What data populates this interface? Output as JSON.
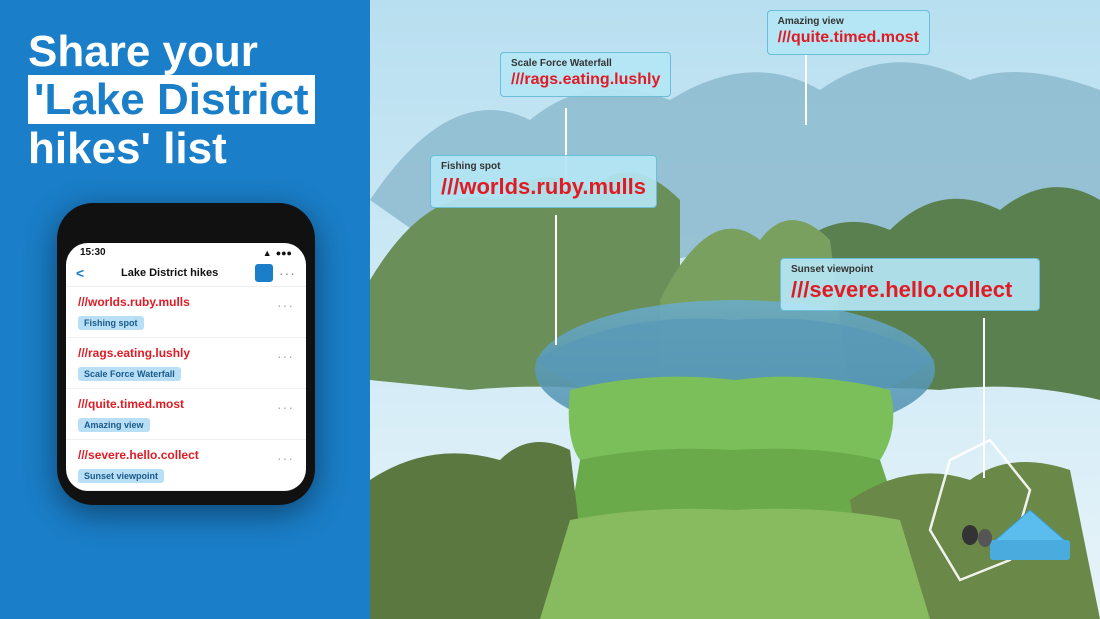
{
  "leftPanel": {
    "headline": {
      "line1": "Share your",
      "line2": "'Lake District",
      "line3": "hikes' list"
    },
    "accentColor": "#1a7ec8"
  },
  "phone": {
    "statusBar": {
      "time": "15:30",
      "icons": "WiFi Signal"
    },
    "navBar": {
      "backLabel": "<",
      "title": "Lake District hikes",
      "dotsLabel": "..."
    },
    "listItems": [
      {
        "w3w": "///worlds.ruby.mulls",
        "tag": "Fishing spot"
      },
      {
        "w3w": "///rags.eating.lushly",
        "tag": "Scale Force Waterfall"
      },
      {
        "w3w": "///quite.timed.most",
        "tag": "Amazing view"
      },
      {
        "w3w": "///severe.hello.collect",
        "tag": "Sunset viewpoint"
      }
    ]
  },
  "callouts": [
    {
      "id": "callout-scale-force",
      "label": "Scale Force Waterfall",
      "w3w": "///rags.eating.lushly"
    },
    {
      "id": "callout-amazing-view",
      "label": "Amazing view",
      "w3w": "///quite.timed.most"
    },
    {
      "id": "callout-fishing-spot",
      "label": "Fishing spot",
      "w3w": "///worlds.ruby.mulls"
    },
    {
      "id": "callout-sunset",
      "label": "Sunset viewpoint",
      "w3w": "///severe.hello.collect"
    }
  ],
  "bottomText": "severe hello collect"
}
